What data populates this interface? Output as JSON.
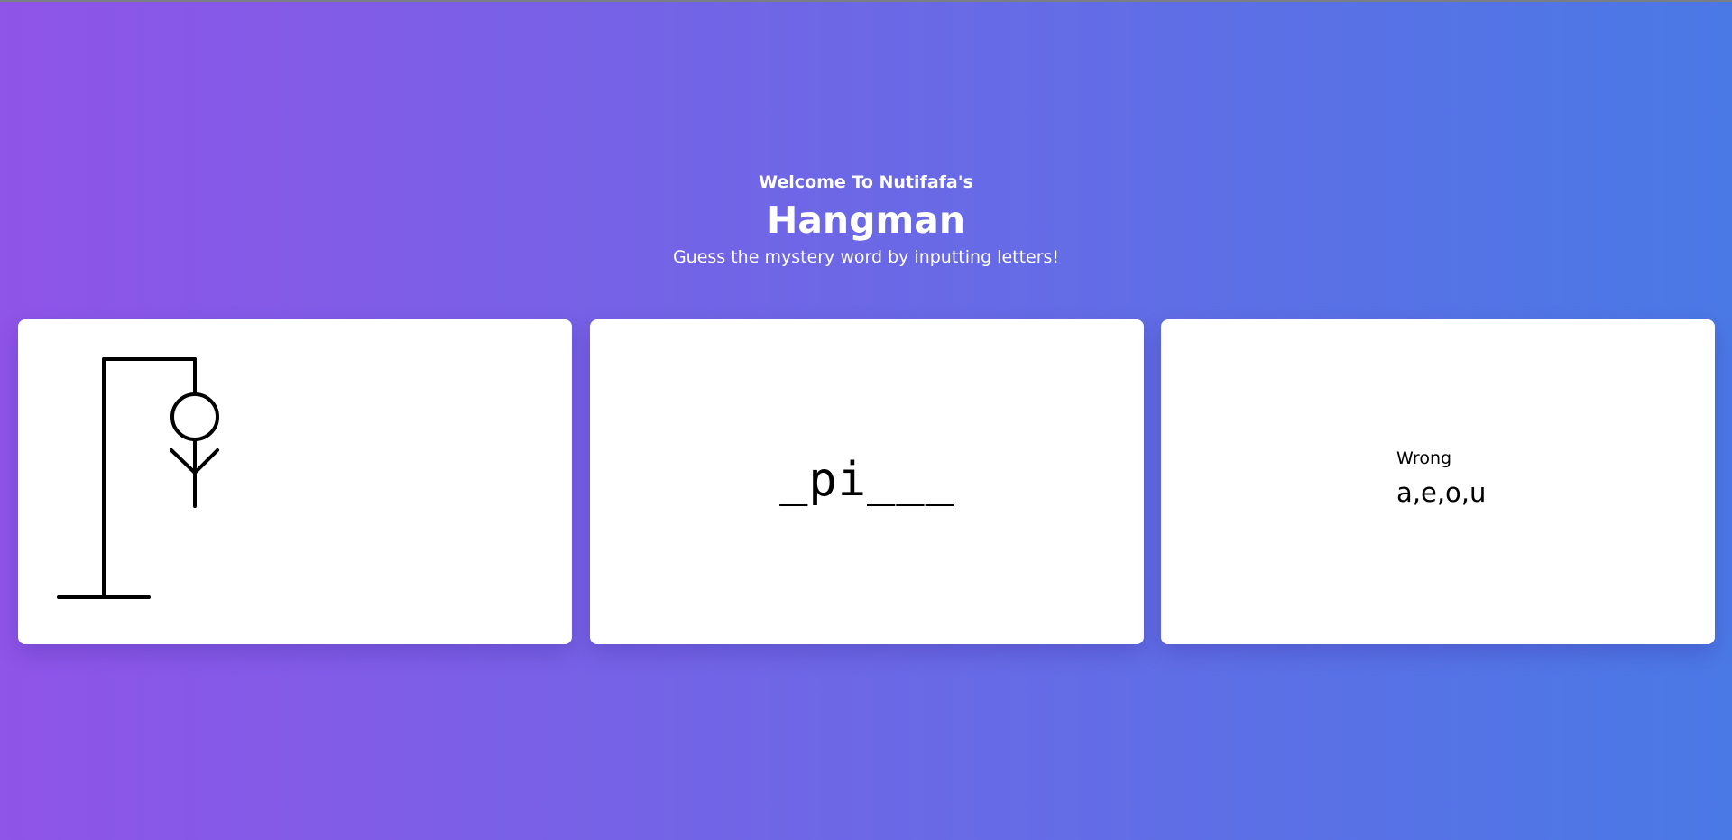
{
  "header": {
    "welcome": "Welcome To Nutifafa's",
    "title": "Hangman",
    "subtitle": "Guess the mystery word by inputting letters!"
  },
  "game": {
    "word_display": "_pi___",
    "wrong_label": "Wrong",
    "wrong_letters": "a,e,o,u",
    "figure_parts_shown": [
      "gallows",
      "head",
      "body",
      "arms"
    ]
  },
  "colors": {
    "gradient_start": "#8f54e8",
    "gradient_end": "#4a79e6",
    "card": "#ffffff",
    "ink": "#000000"
  }
}
